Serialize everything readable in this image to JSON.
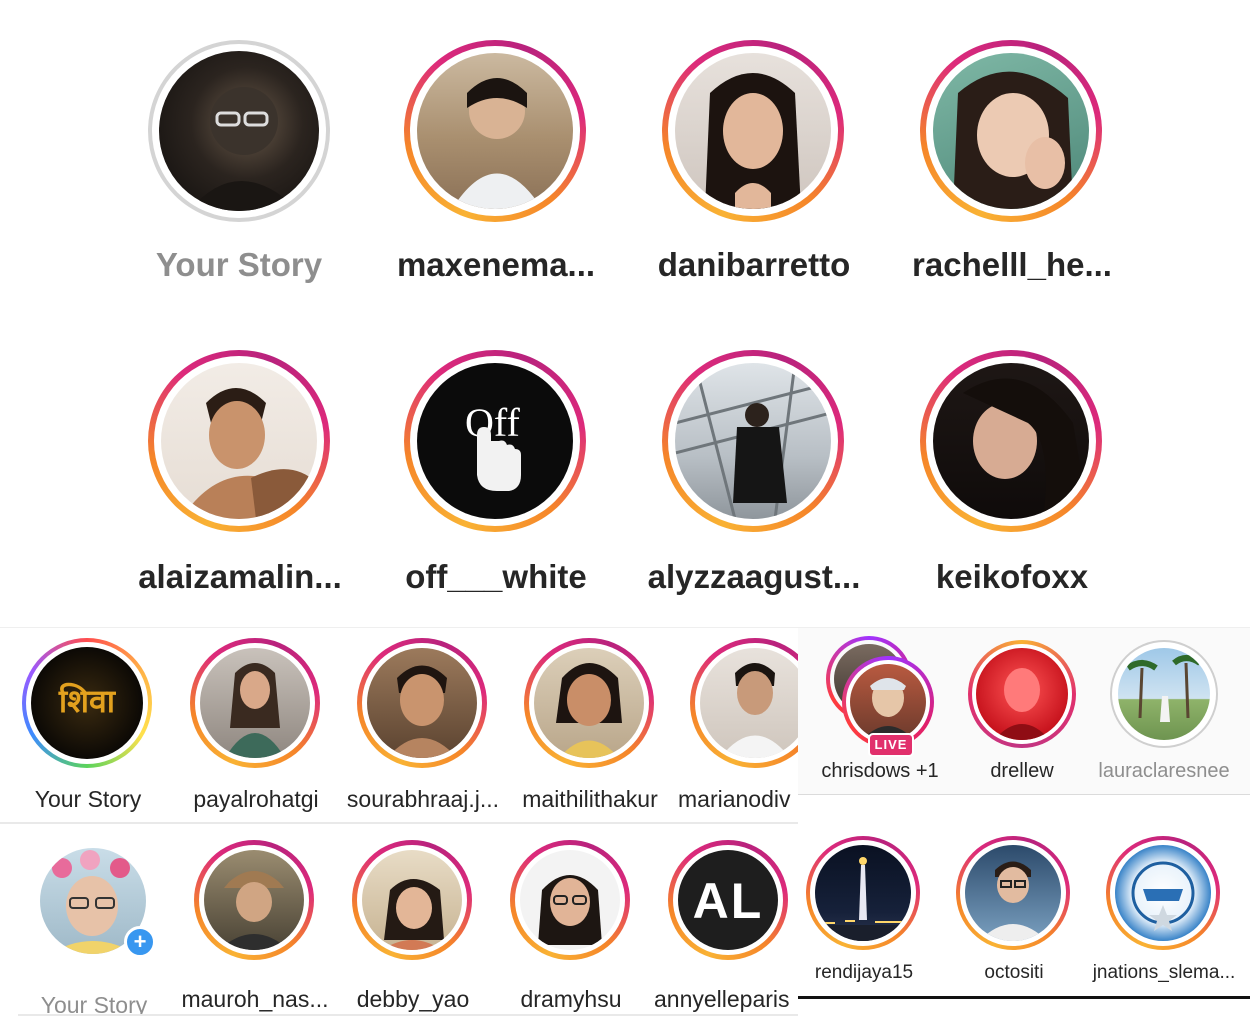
{
  "top_grid": {
    "row1": [
      {
        "username": "Your Story"
      },
      {
        "username": "maxenema..."
      },
      {
        "username": "danibarretto"
      },
      {
        "username": "rachelll_he..."
      }
    ],
    "row2": [
      {
        "username": "alaizamalin..."
      },
      {
        "username": "off___white",
        "avatar_text": "Off"
      },
      {
        "username": "alyzzaagust..."
      },
      {
        "username": "keikofoxx"
      }
    ]
  },
  "strip_a": [
    {
      "username": "Your Story",
      "avatar_text": "शिवा"
    },
    {
      "username": "payalrohatgi"
    },
    {
      "username": "sourabhraaj.j..."
    },
    {
      "username": "maithilithakur"
    },
    {
      "username": "marianodiv"
    }
  ],
  "strip_b": [
    {
      "username": "chrisdows +1",
      "badge": "LIVE"
    },
    {
      "username": "drellew"
    },
    {
      "username": "lauraclaresnee"
    }
  ],
  "strip_c": [
    {
      "username": "Your Story",
      "badge": "+"
    },
    {
      "username": "mauroh_nas..."
    },
    {
      "username": "debby_yao"
    },
    {
      "username": "dramyhsu"
    },
    {
      "username": "annyelleparis",
      "avatar_text": "AL"
    }
  ],
  "strip_d": [
    {
      "username": "rendijaya15"
    },
    {
      "username": "octositi"
    },
    {
      "username": "jnations_slema..."
    }
  ],
  "colors": {
    "ring_start": "#f9b234",
    "ring_mid": "#dd2a7b",
    "ring_end": "#b8227d",
    "seen_ring": "#d4d4d4",
    "live_badge": "#e1306c",
    "add_badge": "#3897f0",
    "text": "#262626",
    "muted_text": "#8e8e8e"
  }
}
